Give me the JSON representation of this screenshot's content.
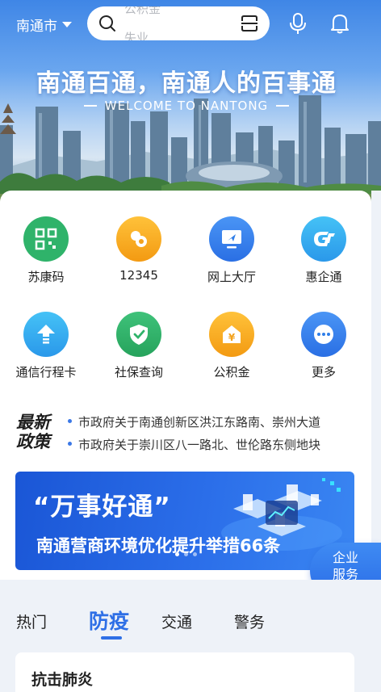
{
  "topbar": {
    "city": "南通市",
    "search_hint_1": "公积金",
    "search_hint_2": "失业"
  },
  "hero": {
    "title": "南通百通，南通人的百事通",
    "subtitle": "WELCOME TO NANTONG"
  },
  "services": [
    {
      "label": "苏康码",
      "icon": "qr-code-icon",
      "color": "#2fb36a"
    },
    {
      "label": "12345",
      "icon": "hotline-icon",
      "color": "#f3a21c"
    },
    {
      "label": "网上大厅",
      "icon": "online-hall-icon",
      "color": "#2f7ee8"
    },
    {
      "label": "惠企通",
      "icon": "enterprise-icon",
      "color": "#2aa7ee"
    },
    {
      "label": "通信行程卡",
      "icon": "trip-card-icon",
      "color": "#2aa7ee"
    },
    {
      "label": "社保查询",
      "icon": "shield-check-icon",
      "color": "#2fb36a"
    },
    {
      "label": "公积金",
      "icon": "fund-icon",
      "color": "#f3a21c"
    },
    {
      "label": "更多",
      "icon": "more-icon",
      "color": "#2f7ee8"
    }
  ],
  "news": {
    "brand": "最新政策",
    "items": [
      "市政府关于南通创新区洪江东路南、崇州大道",
      "市政府关于崇川区八一路北、世伦路东侧地块"
    ]
  },
  "banner": {
    "title": "“万事好通”",
    "subtitle": "南通营商环境优化提升举措66条"
  },
  "enterprise": {
    "line1": "企业",
    "line2": "服务"
  },
  "tabs": [
    "热门",
    "防疫",
    "交通",
    "警务"
  ],
  "active_tab": "防疫",
  "section": {
    "title": "抗击肺炎"
  }
}
